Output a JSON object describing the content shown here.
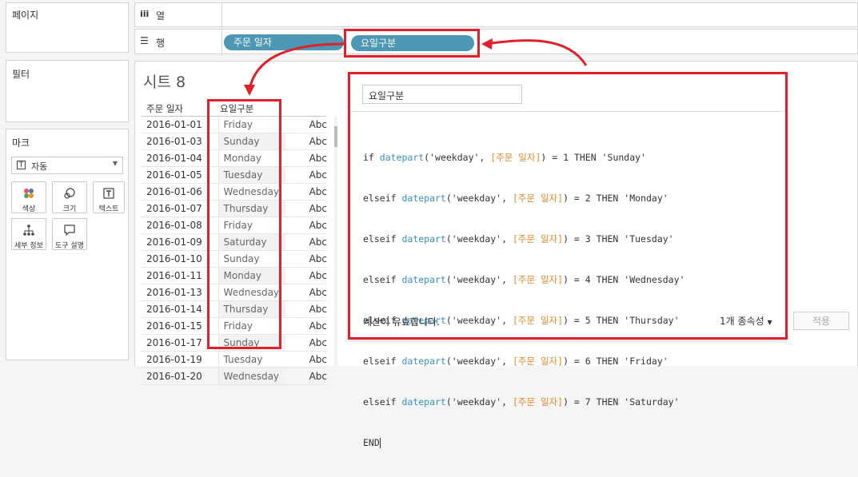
{
  "left_panel": {
    "pages_title": "페이지",
    "filters_title": "필터",
    "marks_title": "마크",
    "marks_type": "자동",
    "mark_buttons": [
      {
        "label": "색상",
        "icon": "color-dots-icon"
      },
      {
        "label": "크기",
        "icon": "size-icon"
      },
      {
        "label": "텍스트",
        "icon": "text-icon"
      },
      {
        "label": "세부 정보",
        "icon": "detail-icon"
      },
      {
        "label": "도구 설명",
        "icon": "tooltip-icon"
      }
    ]
  },
  "shelves": {
    "columns_icon": "iii",
    "columns_label": "열",
    "rows_icon": "☰",
    "rows_label": "행",
    "row_pills": [
      "주문 일자",
      "요일구분"
    ]
  },
  "sheet": {
    "title": "시트 8",
    "headers": [
      "주문 일자",
      "요일구분"
    ],
    "rows": [
      {
        "date": "2016-01-01",
        "day": "Friday",
        "value": "Abc"
      },
      {
        "date": "2016-01-03",
        "day": "Sunday",
        "value": "Abc"
      },
      {
        "date": "2016-01-04",
        "day": "Monday",
        "value": "Abc"
      },
      {
        "date": "2016-01-05",
        "day": "Tuesday",
        "value": "Abc"
      },
      {
        "date": "2016-01-06",
        "day": "Wednesday",
        "value": "Abc"
      },
      {
        "date": "2016-01-07",
        "day": "Thursday",
        "value": "Abc"
      },
      {
        "date": "2016-01-08",
        "day": "Friday",
        "value": "Abc"
      },
      {
        "date": "2016-01-09",
        "day": "Saturday",
        "value": "Abc"
      },
      {
        "date": "2016-01-10",
        "day": "Sunday",
        "value": "Abc"
      },
      {
        "date": "2016-01-11",
        "day": "Monday",
        "value": "Abc"
      },
      {
        "date": "2016-01-13",
        "day": "Wednesday",
        "value": "Abc"
      },
      {
        "date": "2016-01-14",
        "day": "Thursday",
        "value": "Abc"
      },
      {
        "date": "2016-01-15",
        "day": "Friday",
        "value": "Abc"
      },
      {
        "date": "2016-01-17",
        "day": "Sunday",
        "value": "Abc"
      },
      {
        "date": "2016-01-19",
        "day": "Tuesday",
        "value": "Abc"
      },
      {
        "date": "2016-01-20",
        "day": "Wednesday",
        "value": "Abc"
      }
    ]
  },
  "calc_dialog": {
    "name": "요일구분",
    "lines": [
      {
        "kw": "if ",
        "num": "1",
        "day": "'Sunday'"
      },
      {
        "kw": "elseif ",
        "num": "2",
        "day": "'Monday'"
      },
      {
        "kw": "elseif ",
        "num": "3",
        "day": "'Tuesday'"
      },
      {
        "kw": "elseif ",
        "num": "4",
        "day": "'Wednesday'"
      },
      {
        "kw": "elseif ",
        "num": "5",
        "day": "'Thursday'"
      },
      {
        "kw": "elseif ",
        "num": "6",
        "day": "'Friday'"
      },
      {
        "kw": "elseif ",
        "num": "7",
        "day": "'Saturday'"
      }
    ],
    "fn_name": "datepart",
    "arg_str": "'weekday'",
    "field_ref": "[주문 일자]",
    "then_kw": "THEN",
    "end_kw": "END",
    "status": "계산이 유효합니다.",
    "dependencies": "1개 종속성",
    "apply_label": "적용"
  },
  "accent_colors": {
    "pill": "#4c97b3",
    "highlight": "#e0202a",
    "field": "#e08a2c",
    "function": "#3a8fbd"
  }
}
